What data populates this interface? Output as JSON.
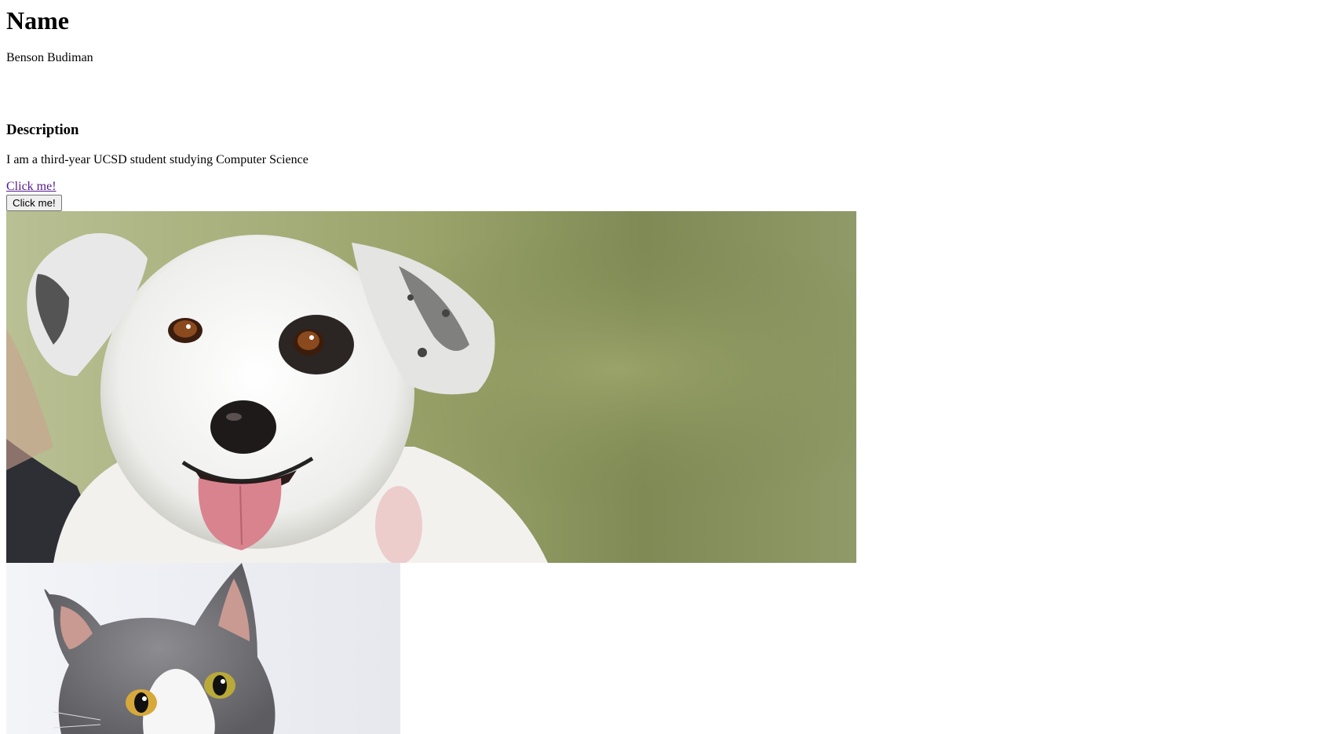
{
  "heading": "Name",
  "name": "Benson Budiman",
  "description_heading": "Description",
  "description": "I am a third-year UCSD student studying Computer Science",
  "link_label": "Click me!",
  "button_label": "Click me!",
  "colors": {
    "link": "#551a8b",
    "button_bg": "#efefef",
    "dog_background": "#8a9660",
    "cat_background": "#eef0f4"
  }
}
